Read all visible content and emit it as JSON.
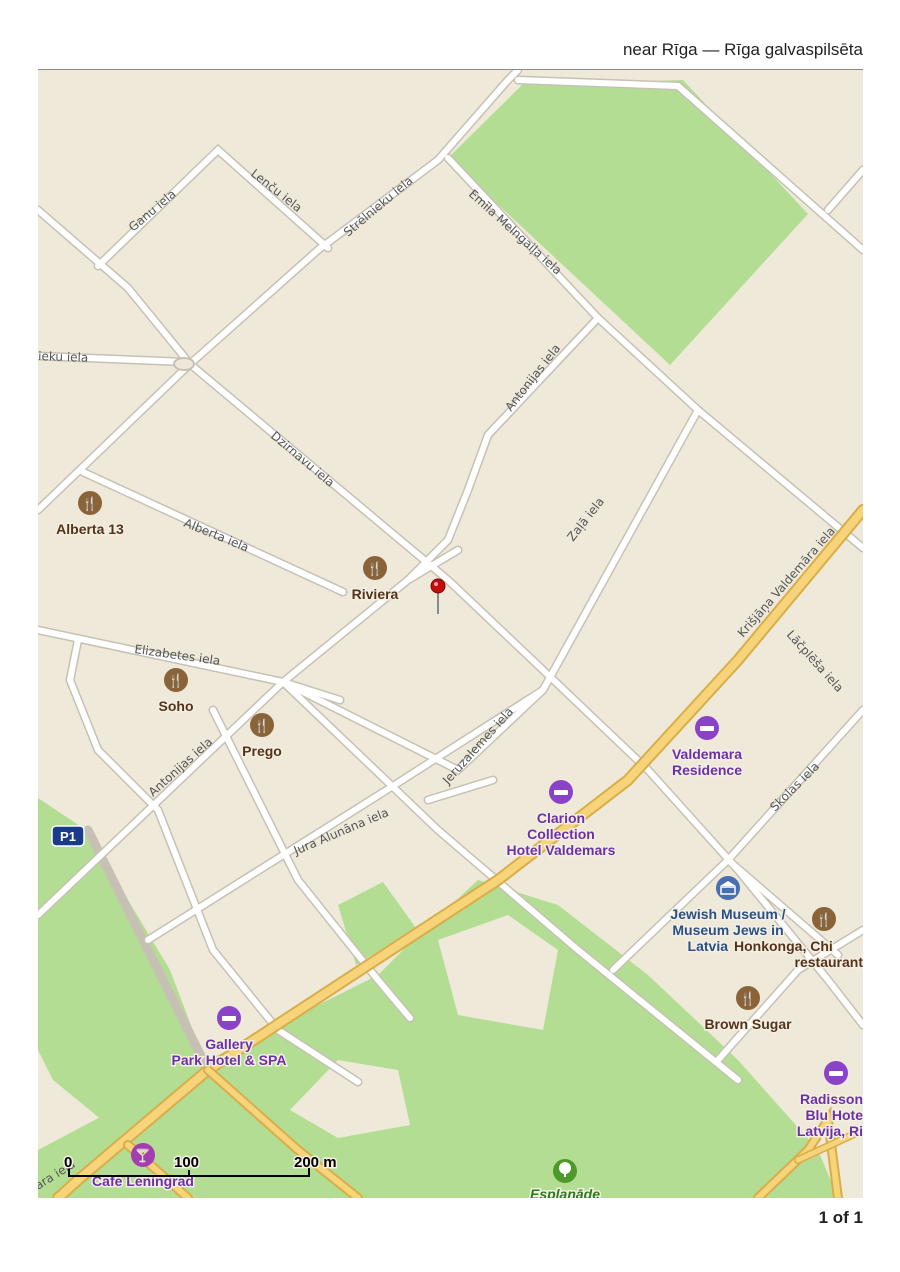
{
  "header": {
    "title": "near Rīga — Rīga galvaspilsēta"
  },
  "map": {
    "streets": {
      "ganu": "Ganu iela",
      "lencu": "Lenču iela",
      "strelnieku": "Strēlnieku iela",
      "emila": "Emīla Melngaiļa iela",
      "eku": "ieku iela",
      "antonijas_n": "Antonijas iela",
      "dzirnavu": "Dzirnavu iela",
      "zala": "Zaļā iela",
      "alberta": "Alberta iela",
      "krisjana": "Krišjāņa Valdemāra iela",
      "elizabetes": "Elizabetes iela",
      "laclplesa": "Lāčplēša iela",
      "jeruzalemes": "Jeruzalemes iela",
      "antonijas_s": "Antonijas iela",
      "skolas": "Skolas iela",
      "jura": "Jura Alunāna iela",
      "rara": "ara iela"
    },
    "pois": {
      "alberta13": "Alberta 13",
      "riviera": "Riviera",
      "soho": "Soho",
      "prego": "Prego",
      "valdemara_l1": "Valdemara",
      "valdemara_l2": "Residence",
      "clarion_l1": "Clarion",
      "clarion_l2": "Collection",
      "clarion_l3": "Hotel Valdemars",
      "museum_l1": "Jewish Museum /",
      "museum_l2": "Museum Jews in",
      "museum_l3": "Latvia",
      "honkonga_l1": "Honkonga, Chi",
      "honkonga_l2": "restaurant",
      "brownsugar": "Brown Sugar",
      "radisson_l1": "Radisson",
      "radisson_l2": "Blu Hote",
      "radisson_l3": "Latvija, Ri",
      "gallery_l1": "Gallery",
      "gallery_l2": "Park Hotel & SPA",
      "cafe": "Cafe Leningrad",
      "esplanade": "Esplanāde"
    },
    "route_shield": "P1",
    "scale": {
      "zero": "0",
      "mid": "100",
      "end": "200 m"
    },
    "colors": {
      "land": "#efe9da",
      "park": "#b4dd94",
      "road": "#ffffff",
      "major_road": "#f7d37a",
      "restaurant": "#8a6438",
      "hotel": "#8a43c6",
      "museum": "#4a6fb0",
      "park_icon": "#4d9a2a",
      "pin": "#c40d0d"
    }
  },
  "footer": {
    "page_indicator": "1 of 1"
  }
}
